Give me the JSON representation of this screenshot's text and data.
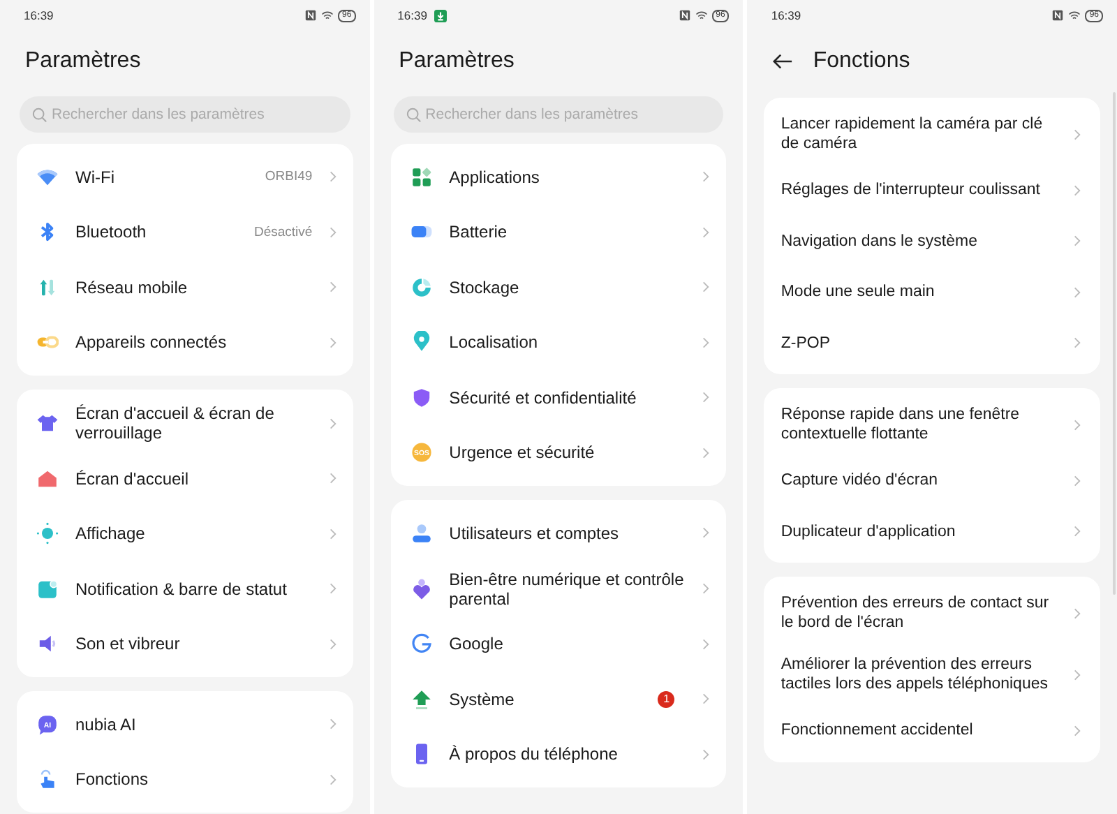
{
  "screens": [
    {
      "status_bar": {
        "time": "16:39",
        "download_notification": false,
        "battery": "96"
      },
      "header": {
        "title": "Paramètres",
        "back": false
      },
      "search": {
        "placeholder": "Rechercher dans les paramètres"
      },
      "groups": [
        {
          "items": [
            {
              "kind": "wifi",
              "label": "Wi-Fi",
              "value": "ORBI49"
            },
            {
              "kind": "bluetooth",
              "label": "Bluetooth",
              "value": "Désactivé"
            },
            {
              "kind": "mobile",
              "label": "Réseau mobile"
            },
            {
              "kind": "devices",
              "label": "Appareils connectés"
            }
          ]
        },
        {
          "items": [
            {
              "kind": "theme",
              "label": "Écran d'accueil & écran de verrouillage"
            },
            {
              "kind": "home",
              "label": "Écran d'accueil"
            },
            {
              "kind": "display",
              "label": "Affichage"
            },
            {
              "kind": "notification",
              "label": "Notification & barre de statut"
            },
            {
              "kind": "sound",
              "label": "Son et vibreur"
            }
          ]
        },
        {
          "items": [
            {
              "kind": "ai",
              "icon_text": "AI",
              "label": "nubia AI"
            },
            {
              "kind": "gesture",
              "label": "Fonctions"
            }
          ]
        }
      ]
    },
    {
      "status_bar": {
        "time": "16:39",
        "download_notification": true,
        "battery": "96"
      },
      "header": {
        "title": "Paramètres",
        "back": false
      },
      "search": {
        "placeholder": "Rechercher dans les paramètres"
      },
      "groups": [
        {
          "items": [
            {
              "kind": "apps",
              "label": "Applications"
            },
            {
              "kind": "battery",
              "label": "Batterie"
            },
            {
              "kind": "storage",
              "label": "Stockage"
            },
            {
              "kind": "location",
              "label": "Localisation"
            },
            {
              "kind": "shield",
              "label": "Sécurité et confidentialité"
            },
            {
              "kind": "sos",
              "icon_text": "SOS",
              "label": "Urgence et sécurité"
            }
          ]
        },
        {
          "items": [
            {
              "kind": "user",
              "label": "Utilisateurs et comptes"
            },
            {
              "kind": "wellbeing",
              "label": "Bien-être numérique et contrôle parental"
            },
            {
              "kind": "google",
              "label": "Google"
            },
            {
              "kind": "update",
              "label": "Système",
              "badge": "1"
            },
            {
              "kind": "phone",
              "label": "À propos du téléphone"
            }
          ]
        }
      ]
    },
    {
      "status_bar": {
        "time": "16:39",
        "download_notification": false,
        "battery": "96"
      },
      "header": {
        "title": "Fonctions",
        "back": true
      },
      "groups": [
        {
          "items": [
            {
              "label": "Lancer rapidement la caméra par clé de caméra"
            },
            {
              "label": "Réglages de l'interrupteur coulissant"
            },
            {
              "label": "Navigation dans le système"
            },
            {
              "label": "Mode une seule main"
            },
            {
              "label": "Z-POP"
            }
          ]
        },
        {
          "items": [
            {
              "label": "Réponse rapide dans une fenêtre contextuelle flottante"
            },
            {
              "label": "Capture vidéo d'écran"
            },
            {
              "label": "Duplicateur d'application"
            }
          ]
        },
        {
          "items": [
            {
              "label": "Prévention des erreurs de contact sur le bord de l'écran"
            },
            {
              "label": "Améliorer la prévention des erreurs tactiles lors des appels téléphoniques"
            },
            {
              "label": "Fonctionnement accidentel"
            }
          ]
        }
      ]
    }
  ]
}
